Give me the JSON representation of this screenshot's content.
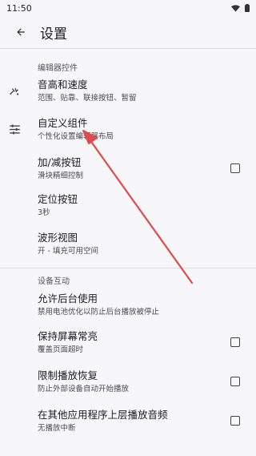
{
  "status": {
    "time": "11:50"
  },
  "appbar": {
    "title": "设置"
  },
  "sections": [
    {
      "header": "编辑器控件",
      "items": [
        {
          "label": "音高和速度",
          "sub": "范围、贴靠、联接按钮、暂留",
          "icon": "pitch-speed-icon"
        },
        {
          "label": "自定义组件",
          "sub": "个性化设置编辑器布局",
          "icon": "tune-icon"
        },
        {
          "label": "加/减按钮",
          "sub": "滑块精细控制",
          "checked": false
        },
        {
          "label": "定位按钮",
          "sub": "3秒"
        },
        {
          "label": "波形视图",
          "sub": "开 - 填充可用空间"
        }
      ]
    },
    {
      "header": "设备互动",
      "items": [
        {
          "label": "允许后台使用",
          "sub": "禁用电池优化以防止后台播放被停止"
        },
        {
          "label": "保持屏幕常亮",
          "sub": "覆盖页面超时",
          "checked": false
        },
        {
          "label": "限制播放恢复",
          "sub": "防止外部设备自动开始播放",
          "checked": false
        },
        {
          "label": "在其他应用程序上层播放音频",
          "sub": "无播放中断",
          "checked": false
        }
      ]
    }
  ],
  "colors": {
    "annotation_arrow": "#e04a4a",
    "background": "#f7f7fa"
  }
}
